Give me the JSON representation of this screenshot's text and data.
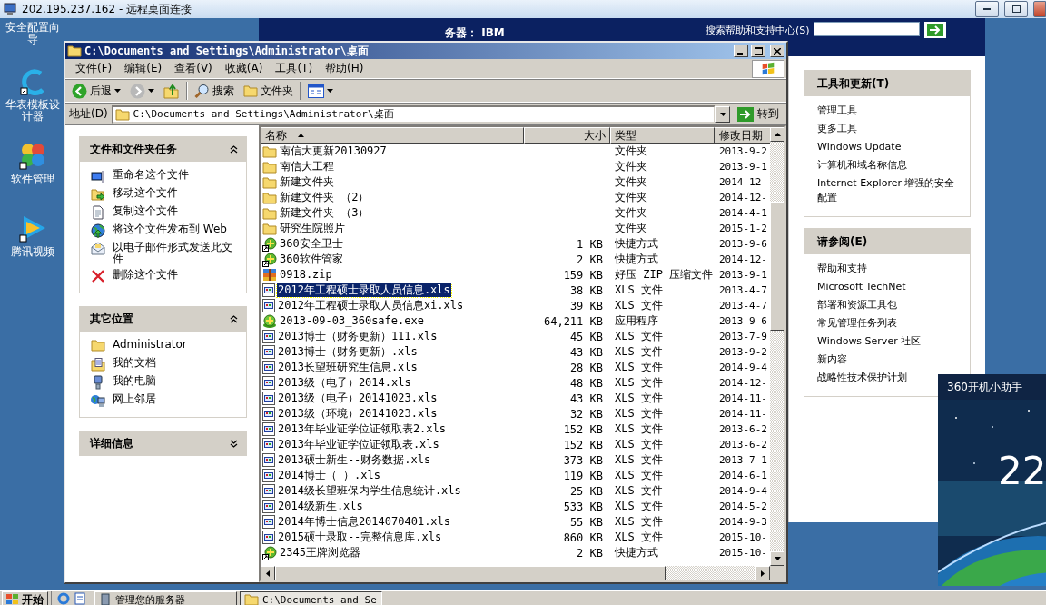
{
  "rdp": {
    "title": "202.195.237.162 - 远程桌面连接"
  },
  "desktop_icons": [
    {
      "label": "安全配置向导"
    },
    {
      "label": "华表模板设计器",
      "kind": "designer"
    },
    {
      "label": "软件管理",
      "kind": "manager"
    },
    {
      "label": "腾讯视频",
      "kind": "video"
    }
  ],
  "server_window": {
    "subtitle": "务器： IBM",
    "search_label": "搜索帮助和支持中心(S)",
    "panels": [
      {
        "title": "工具和更新(T)",
        "links": [
          "管理工具",
          "更多工具",
          "Windows Update",
          "计算机和域名称信息",
          "Internet Explorer 增强的安全配置"
        ]
      },
      {
        "title": "请参阅(E)",
        "links": [
          "帮助和支持",
          "Microsoft TechNet",
          "部署和资源工具包",
          "常见管理任务列表",
          "Windows Server 社区",
          "新内容",
          "战略性技术保护计划"
        ]
      }
    ]
  },
  "explorer": {
    "title": "C:\\Documents and Settings\\Administrator\\桌面",
    "menu": [
      "文件(F)",
      "编辑(E)",
      "查看(V)",
      "收藏(A)",
      "工具(T)",
      "帮助(H)"
    ],
    "toolbar": {
      "back": "后退",
      "search": "搜索",
      "folders": "文件夹"
    },
    "address": {
      "label": "地址(D)",
      "value": "C:\\Documents and Settings\\Administrator\\桌面",
      "go": "转到"
    },
    "task_panels": [
      {
        "title": "文件和文件夹任务",
        "expanded": true,
        "items": [
          {
            "label": "重命名这个文件",
            "kind": "rename"
          },
          {
            "label": "移动这个文件",
            "kind": "move"
          },
          {
            "label": "复制这个文件",
            "kind": "copy"
          },
          {
            "label": "将这个文件发布到 Web",
            "kind": "publish"
          },
          {
            "label": "以电子邮件形式发送此文件",
            "kind": "email"
          },
          {
            "label": "删除这个文件",
            "kind": "delete"
          }
        ]
      },
      {
        "title": "其它位置",
        "expanded": true,
        "items": [
          {
            "label": "Administrator",
            "kind": "folder"
          },
          {
            "label": "我的文档",
            "kind": "documents"
          },
          {
            "label": "我的电脑",
            "kind": "computer"
          },
          {
            "label": "网上邻居",
            "kind": "network"
          }
        ]
      },
      {
        "title": "详细信息",
        "expanded": false
      }
    ],
    "columns": [
      "名称",
      "大小",
      "类型",
      "修改日期"
    ],
    "files": [
      {
        "name": "南信大更新20130927",
        "type": "文件夹",
        "date": "2013-9-2",
        "kind": "folder",
        "selected": false
      },
      {
        "name": "南信大工程",
        "type": "文件夹",
        "date": "2013-9-1",
        "kind": "folder",
        "selected": false
      },
      {
        "name": "新建文件夹",
        "type": "文件夹",
        "date": "2014-12-",
        "kind": "folder",
        "selected": false
      },
      {
        "name": "新建文件夹 （2）",
        "type": "文件夹",
        "date": "2014-12-",
        "kind": "folder",
        "selected": false
      },
      {
        "name": "新建文件夹 （3）",
        "type": "文件夹",
        "date": "2014-4-1",
        "kind": "folder",
        "selected": false
      },
      {
        "name": "研究生院照片",
        "type": "文件夹",
        "date": "2015-1-2",
        "kind": "folder",
        "selected": false
      },
      {
        "name": "360安全卫士",
        "size": "1 KB",
        "type": "快捷方式",
        "date": "2013-9-6",
        "kind": "shortcut",
        "selected": false
      },
      {
        "name": "360软件管家",
        "size": "2 KB",
        "type": "快捷方式",
        "date": "2014-12-",
        "kind": "shortcut",
        "selected": false
      },
      {
        "name": "0918.zip",
        "size": "159 KB",
        "type": "好压 ZIP 压缩文件",
        "date": "2013-9-1",
        "kind": "zip",
        "selected": false
      },
      {
        "name": "2012年工程硕士录取人员信息.xls",
        "size": "38 KB",
        "type": "XLS 文件",
        "date": "2013-4-7",
        "kind": "xls",
        "selected": true
      },
      {
        "name": "2012年工程硕士录取人员信息xi.xls",
        "size": "39 KB",
        "type": "XLS 文件",
        "date": "2013-4-7",
        "kind": "xls",
        "selected": false
      },
      {
        "name": "2013-09-03_360safe.exe",
        "size": "64,211 KB",
        "type": "应用程序",
        "date": "2013-9-6",
        "kind": "exe",
        "selected": false
      },
      {
        "name": "2013博士（财务更新）111.xls",
        "size": "45 KB",
        "type": "XLS 文件",
        "date": "2013-7-9",
        "kind": "xls",
        "selected": false
      },
      {
        "name": "2013博士（财务更新）.xls",
        "size": "43 KB",
        "type": "XLS 文件",
        "date": "2013-9-2",
        "kind": "xls",
        "selected": false
      },
      {
        "name": "2013长望班研究生信息.xls",
        "size": "28 KB",
        "type": "XLS 文件",
        "date": "2014-9-4",
        "kind": "xls",
        "selected": false
      },
      {
        "name": "2013级（电子）2014.xls",
        "size": "48 KB",
        "type": "XLS 文件",
        "date": "2014-12-",
        "kind": "xls",
        "selected": false
      },
      {
        "name": "2013级（电子）20141023.xls",
        "size": "43 KB",
        "type": "XLS 文件",
        "date": "2014-11-",
        "kind": "xls",
        "selected": false
      },
      {
        "name": "2013级（环境）20141023.xls",
        "size": "32 KB",
        "type": "XLS 文件",
        "date": "2014-11-",
        "kind": "xls",
        "selected": false
      },
      {
        "name": "2013年毕业证学位证领取表2.xls",
        "size": "152 KB",
        "type": "XLS 文件",
        "date": "2013-6-2",
        "kind": "xls",
        "selected": false
      },
      {
        "name": "2013年毕业证学位证领取表.xls",
        "size": "152 KB",
        "type": "XLS 文件",
        "date": "2013-6-2",
        "kind": "xls",
        "selected": false
      },
      {
        "name": "2013硕士新生--财务数据.xls",
        "size": "373 KB",
        "type": "XLS 文件",
        "date": "2013-7-1",
        "kind": "xls",
        "selected": false
      },
      {
        "name": "2014博士（ ）.xls",
        "size": "119 KB",
        "type": "XLS 文件",
        "date": "2014-6-1",
        "kind": "xls",
        "selected": false
      },
      {
        "name": "2014级长望班保内学生信息统计.xls",
        "size": "25 KB",
        "type": "XLS 文件",
        "date": "2014-9-4",
        "kind": "xls",
        "selected": false
      },
      {
        "name": "2014级新生.xls",
        "size": "533 KB",
        "type": "XLS 文件",
        "date": "2014-5-2",
        "kind": "xls",
        "selected": false
      },
      {
        "name": "2014年博士信息2014070401.xls",
        "size": "55 KB",
        "type": "XLS 文件",
        "date": "2014-9-3",
        "kind": "xls",
        "selected": false
      },
      {
        "name": "2015硕士录取--完整信息库.xls",
        "size": "860 KB",
        "type": "XLS 文件",
        "date": "2015-10-",
        "kind": "xls",
        "selected": false
      },
      {
        "name": "2345王牌浏览器",
        "size": "2 KB",
        "type": "快捷方式",
        "date": "2015-10-",
        "kind": "shortcut",
        "selected": false
      }
    ]
  },
  "popup": {
    "title": "360开机小助手",
    "value": "22"
  },
  "taskbar": {
    "start": "开始",
    "tasks": [
      {
        "label": "管理您的服务器",
        "selected": false
      },
      {
        "label": "C:\\Documents and Se",
        "selected": true
      }
    ]
  }
}
